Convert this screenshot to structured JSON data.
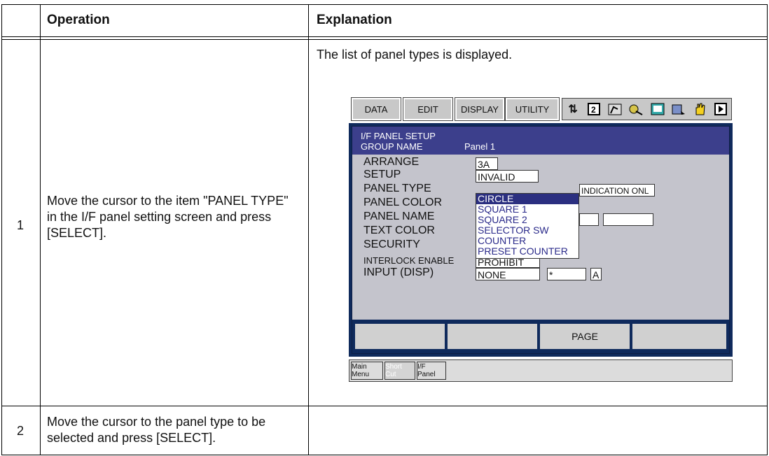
{
  "table": {
    "header": {
      "operation": "Operation",
      "explanation": "Explanation"
    },
    "rows": [
      {
        "num": "1",
        "operation": "Move the cursor to the item \"PANEL TYPE\" in the I/F panel setting screen and press [SELECT].",
        "explanation": "The list of panel types is displayed."
      },
      {
        "num": "2",
        "operation": "Move the cursor to the panel type to be selected and press [SELECT].",
        "explanation": ""
      }
    ]
  },
  "screen": {
    "toolbar": [
      "DATA",
      "EDIT",
      "DISPLAY",
      "UTILITY"
    ],
    "icons": [
      "axis-arrows-icon",
      "page-icon",
      "robot-arm-icon",
      "tools-icon",
      "screen-icon",
      "edit-icon",
      "hand-icon",
      "play-icon"
    ],
    "title": "I/F PANEL SETUP",
    "group_label": "GROUP NAME",
    "group_value": "Panel 1",
    "fields": {
      "arrange": {
        "label": "ARRANGE",
        "value": "3A"
      },
      "setup": {
        "label": "SETUP",
        "value": "INVALID"
      },
      "panel_type": {
        "label": "PANEL TYPE",
        "extra": "INDICATION ONL"
      },
      "panel_color": {
        "label": "PANEL COLOR"
      },
      "panel_name": {
        "label": "PANEL NAME"
      },
      "text_color": {
        "label": "TEXT COLOR"
      },
      "security": {
        "label": "SECURITY"
      },
      "interlock": {
        "label": "INTERLOCK ENABLE",
        "value": "PROHIBIT"
      },
      "input": {
        "label": "INPUT (DISP)",
        "value": "NONE",
        "value2": "*",
        "value3": "A"
      }
    },
    "dropdown": [
      "CIRCLE",
      "SQUARE 1",
      "SQUARE 2",
      "SELECTOR SW",
      "COUNTER",
      "PRESET COUNTER"
    ],
    "fkeys": [
      "",
      "",
      "PAGE",
      ""
    ],
    "bottom": [
      "Main Menu",
      "Short Cut",
      "I/F Panel"
    ]
  }
}
